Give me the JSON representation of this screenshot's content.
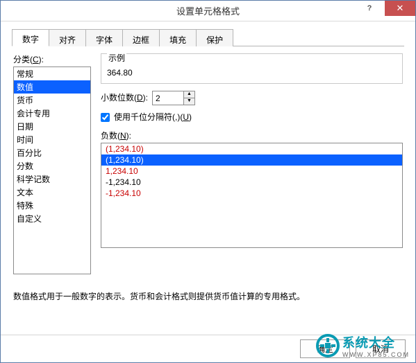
{
  "window": {
    "title": "设置单元格格式"
  },
  "tabs": {
    "items": [
      {
        "label": "数字",
        "active": true
      },
      {
        "label": "对齐",
        "active": false
      },
      {
        "label": "字体",
        "active": false
      },
      {
        "label": "边框",
        "active": false
      },
      {
        "label": "填充",
        "active": false
      },
      {
        "label": "保护",
        "active": false
      }
    ]
  },
  "category": {
    "label_prefix": "分类(",
    "label_u": "C",
    "label_suffix": "):",
    "items": [
      {
        "label": "常规",
        "selected": false
      },
      {
        "label": "数值",
        "selected": true
      },
      {
        "label": "货币",
        "selected": false
      },
      {
        "label": "会计专用",
        "selected": false
      },
      {
        "label": "日期",
        "selected": false
      },
      {
        "label": "时间",
        "selected": false
      },
      {
        "label": "百分比",
        "selected": false
      },
      {
        "label": "分数",
        "selected": false
      },
      {
        "label": "科学记数",
        "selected": false
      },
      {
        "label": "文本",
        "selected": false
      },
      {
        "label": "特殊",
        "selected": false
      },
      {
        "label": "自定义",
        "selected": false
      }
    ]
  },
  "example": {
    "group_label": "示例",
    "value": "364.80"
  },
  "decimals": {
    "label_prefix": "小数位数(",
    "label_u": "D",
    "label_suffix": "):",
    "value": "2"
  },
  "thousands": {
    "checked": true,
    "label_prefix": "使用千位分隔符(,)(",
    "label_u": "U",
    "label_suffix": ")"
  },
  "negative": {
    "label_prefix": "负数(",
    "label_u": "N",
    "label_suffix": "):",
    "items": [
      {
        "label": "(1,234.10)",
        "red": true,
        "selected": false
      },
      {
        "label": "(1,234.10)",
        "red": false,
        "selected": true
      },
      {
        "label": "1,234.10",
        "red": true,
        "selected": false
      },
      {
        "label": "-1,234.10",
        "red": false,
        "selected": false
      },
      {
        "label": "-1,234.10",
        "red": true,
        "selected": false
      }
    ]
  },
  "description": "数值格式用于一般数字的表示。货币和会计格式则提供货币值计算的专用格式。",
  "buttons": {
    "ok": "确定",
    "cancel": "取消"
  },
  "brand": {
    "name": "系统大全",
    "sub": "WWW.XP85.COM"
  }
}
